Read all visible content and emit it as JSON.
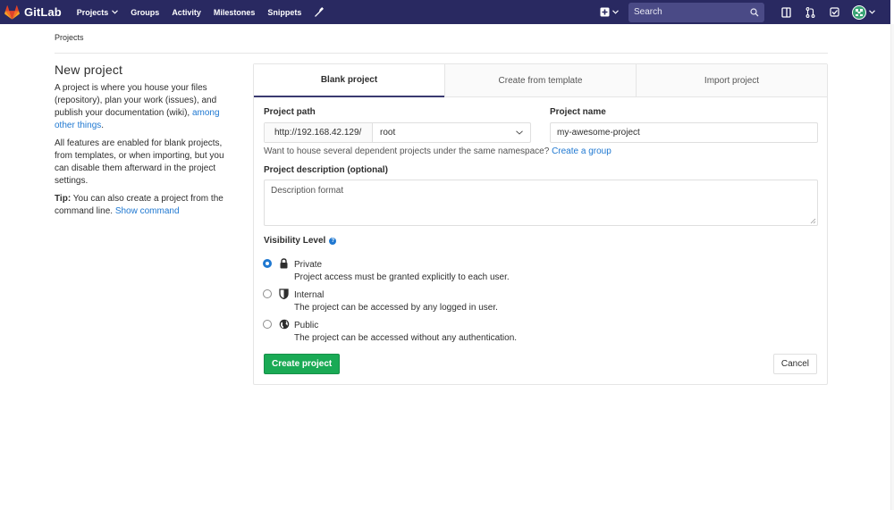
{
  "navbar": {
    "brand": "GitLab",
    "links": [
      {
        "label": "Projects",
        "dropdown": true
      },
      {
        "label": "Groups"
      },
      {
        "label": "Activity"
      },
      {
        "label": "Milestones"
      },
      {
        "label": "Snippets"
      }
    ],
    "search_placeholder": "Search",
    "bg_color": "#292961"
  },
  "breadcrumb": "Projects",
  "sidebar": {
    "title": "New project",
    "intro": "A project is where you house your files (repository), plan your work (issues), and publish your documentation (wiki), ",
    "intro_link": "among other things",
    "intro_end": ".",
    "features": "All features are enabled for blank projects, from templates, or when importing, but you can disable them afterward in the project settings.",
    "tip_label": "Tip:",
    "tip_text": " You can also create a project from the command line. ",
    "tip_link": "Show command"
  },
  "tabs": [
    {
      "label": "Blank project",
      "active": true
    },
    {
      "label": "Create from template",
      "active": false
    },
    {
      "label": "Import project",
      "active": false
    }
  ],
  "form": {
    "project_path_label": "Project path",
    "path_prefix": "http://192.168.42.129/",
    "namespace": "root",
    "project_name_label": "Project name",
    "project_name_value": "my-awesome-project",
    "help_text": "Want to house several dependent projects under the same namespace? ",
    "help_link": "Create a group",
    "description_label": "Project description (optional)",
    "description_placeholder": "Description format",
    "visibility_label": "Visibility Level",
    "visibility": [
      {
        "title": "Private",
        "desc": "Project access must be granted explicitly to each user.",
        "icon": "lock-icon",
        "checked": true
      },
      {
        "title": "Internal",
        "desc": "The project can be accessed by any logged in user.",
        "icon": "shield-icon",
        "checked": false
      },
      {
        "title": "Public",
        "desc": "The project can be accessed without any authentication.",
        "icon": "globe-icon",
        "checked": false
      }
    ],
    "create_button": "Create project",
    "cancel_button": "Cancel",
    "accent_color": "#1aaa55",
    "link_color": "#1f78d1"
  }
}
